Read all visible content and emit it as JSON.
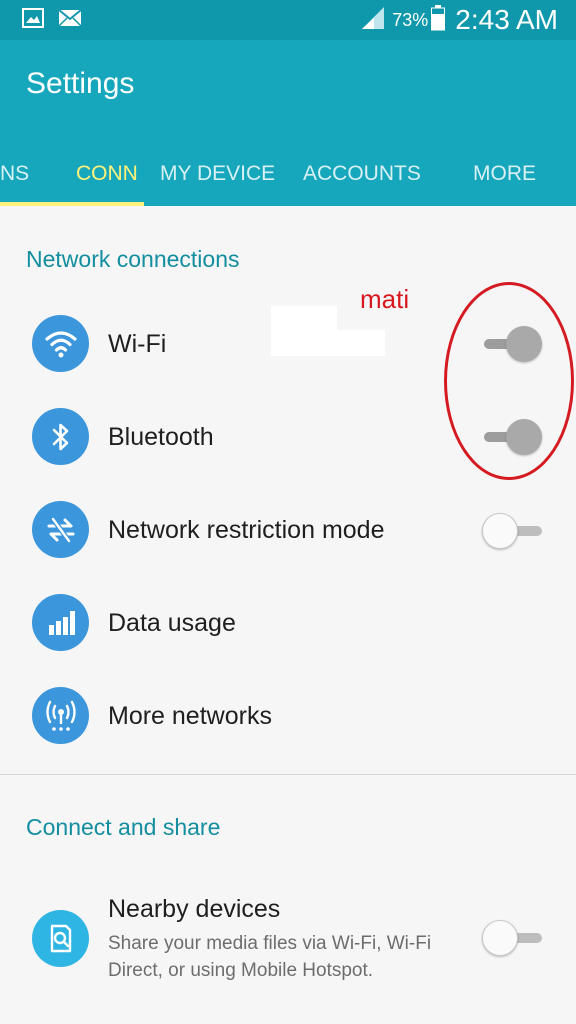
{
  "status_bar": {
    "left_icons": [
      "gallery-icon",
      "email-icon"
    ],
    "signal_icon": "cell-signal-icon",
    "battery_percent": "73%",
    "battery_icon": "battery-icon",
    "time": "2:43 AM"
  },
  "app_bar": {
    "title": "Settings",
    "tabs": [
      {
        "label": "NS",
        "active": false
      },
      {
        "label": "CONN",
        "active": true
      },
      {
        "label": "MY DEVICE",
        "active": false
      },
      {
        "label": "ACCOUNTS",
        "active": false
      },
      {
        "label": "MORE",
        "active": false
      }
    ],
    "accent_color": "#fff27a",
    "background_color": "#17a7bc"
  },
  "network_connections": {
    "header": "Network connections",
    "items": [
      {
        "label": "Wi-Fi",
        "icon": "wifi-icon",
        "toggle": "on"
      },
      {
        "label": "Bluetooth",
        "icon": "bluetooth-icon",
        "toggle": "on"
      },
      {
        "label": "Network restriction mode",
        "icon": "network-restriction-icon",
        "toggle": "off"
      },
      {
        "label": "Data usage",
        "icon": "data-usage-icon"
      },
      {
        "label": "More networks",
        "icon": "more-networks-icon"
      }
    ]
  },
  "connect_and_share": {
    "header": "Connect and share",
    "items": [
      {
        "label": "Nearby devices",
        "sub": "Share your media files via Wi-Fi, Wi-Fi Direct, or using Mobile Hotspot.",
        "icon": "nearby-devices-icon",
        "toggle": "off"
      }
    ]
  },
  "annotation": {
    "text": "mati",
    "color": "#d51b22"
  }
}
